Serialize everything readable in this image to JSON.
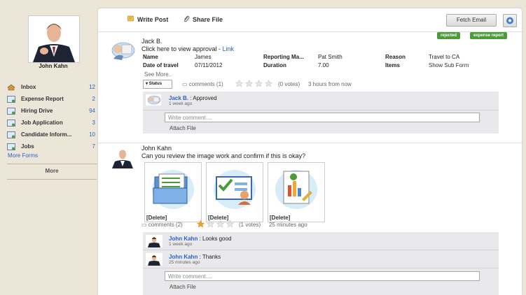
{
  "profile": {
    "name": "John Kahn"
  },
  "sidebar": {
    "items": [
      {
        "label": "Inbox",
        "count": "12",
        "icon": "home-icon"
      },
      {
        "label": "Expense Report",
        "count": "2",
        "icon": "form-icon"
      },
      {
        "label": "Hiring Drive",
        "count": "94",
        "icon": "form-icon"
      },
      {
        "label": "Job Application",
        "count": "3",
        "icon": "form-icon"
      },
      {
        "label": "Candidate Inform...",
        "count": "10",
        "icon": "form-icon"
      },
      {
        "label": "Jobs",
        "count": "7",
        "icon": "form-icon"
      }
    ],
    "more_forms": "More Forms",
    "more": "More"
  },
  "toolbar": {
    "write_post": "Write Post",
    "share_file": "Share File",
    "fetch_email": "Fetch Email"
  },
  "post1": {
    "tags": [
      "rejected",
      "expense report"
    ],
    "author": "Jack B.",
    "text": "Click here to view approval - ",
    "link": "Link",
    "fields": [
      {
        "k1": "Name",
        "v1": "James",
        "k2": "Reporting Ma...",
        "v2": "Pat Smith",
        "k3": "Reason",
        "v3": "Travel to CA"
      },
      {
        "k1": "Date of travel",
        "v1": "07/11/2012",
        "k2": "Duration",
        "v2": "7.00",
        "k3": "Items",
        "v3": "Show Sub Form"
      }
    ],
    "see_more": "See More..",
    "status": "Status",
    "comments": "comments (1)",
    "votes": "(0 votes)",
    "time": "3 hours from now",
    "comment": {
      "author": "Jack B.",
      "text": ": Approved",
      "time": "1 week ago"
    },
    "placeholder": "Write comment....",
    "attach": "Attach File"
  },
  "post2": {
    "author": "John Kahn",
    "text": "Can you review the image work and confirm if this is okay?",
    "delete": "[Delete]",
    "comments": "comments (2)",
    "votes": "(1 votes)",
    "time": "25 minutes ago",
    "comments_list": [
      {
        "author": "John Kahn",
        "text": ": Looks good",
        "time": "1 week ago"
      },
      {
        "author": "John Kahn",
        "text": ": Thanks",
        "time": "25 minutes ago"
      }
    ],
    "placeholder": "Write comment....",
    "attach": "Attach File"
  },
  "colors": {
    "accent": "#2a62c9",
    "tag": "#4c9b3a",
    "sidebar_bg": "#ece6d9"
  }
}
